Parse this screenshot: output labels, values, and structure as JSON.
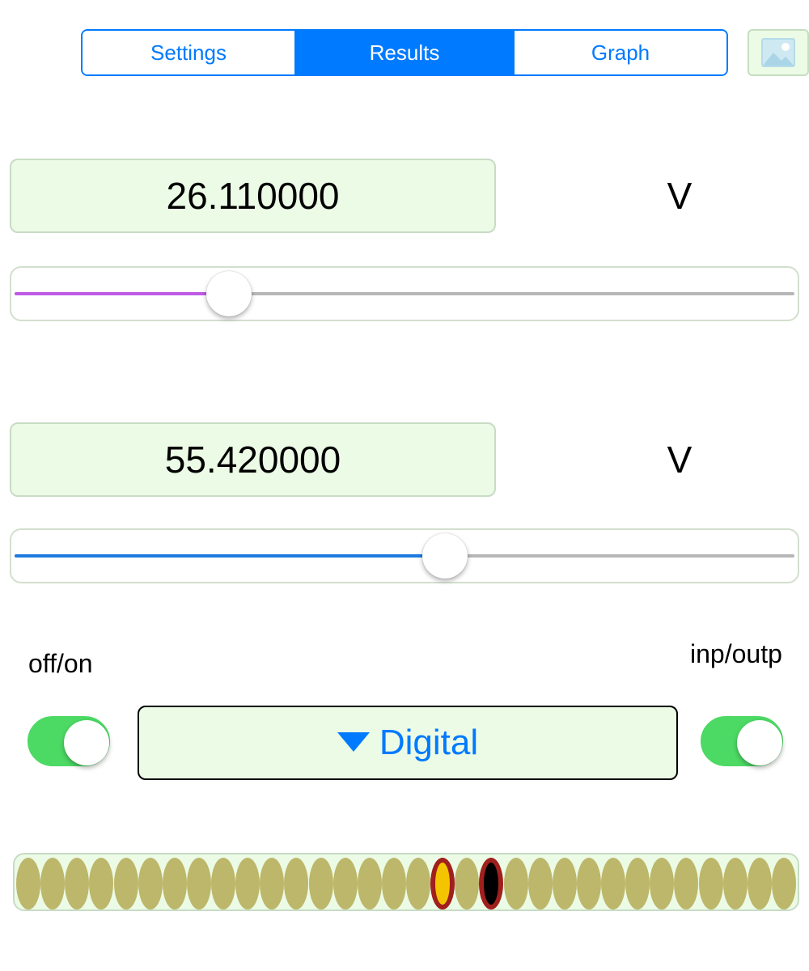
{
  "tabs": [
    {
      "label": "Settings",
      "active": false
    },
    {
      "label": "Results",
      "active": true
    },
    {
      "label": "Graph",
      "active": false
    }
  ],
  "image_button_icon": "image-icon",
  "channels": [
    {
      "value": "26.110000",
      "unit": "V",
      "slider_fraction": 0.275,
      "fill_color": "#BF5AE6"
    },
    {
      "value": "55.420000",
      "unit": "V",
      "slider_fraction": 0.552,
      "fill_color": "#1E7BE0"
    }
  ],
  "controls": {
    "left_label": "off/on",
    "right_label": "inp/outp",
    "left_toggle_on": true,
    "right_toggle_on": true,
    "mode_dropdown": "Digital",
    "dropdown_icon": "triangle-down-icon"
  },
  "led_strip": {
    "count": 32,
    "default_color": "#BDB76B",
    "highlighted": [
      {
        "index": 17,
        "fill": "#F5C400",
        "ring": "#A0201E"
      },
      {
        "index": 19,
        "fill": "#000000",
        "ring": "#A0201E"
      }
    ]
  },
  "colors": {
    "accent": "#007AFF",
    "field_background": "#ECFBE6",
    "toggle_on": "#4CD964"
  }
}
